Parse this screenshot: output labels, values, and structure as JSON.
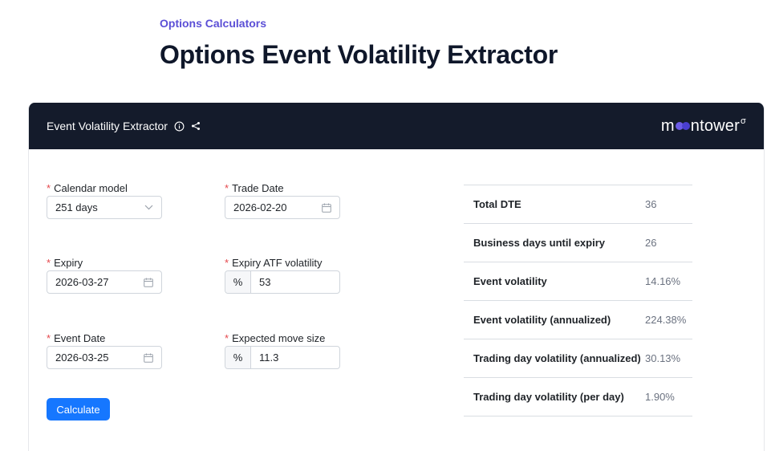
{
  "page": {
    "eyebrow": "Options Calculators",
    "title": "Options Event Volatility Extractor"
  },
  "card": {
    "title": "Event Volatility Extractor",
    "brand": {
      "pre": "m",
      "post": "ntower",
      "sup": "σ"
    }
  },
  "form": {
    "calendar_model": {
      "label": "Calendar model",
      "value": "251 days"
    },
    "trade_date": {
      "label": "Trade Date",
      "value": "2026-02-20"
    },
    "expiry": {
      "label": "Expiry",
      "value": "2026-03-27"
    },
    "expiry_atf_vol": {
      "label": "Expiry ATF volatility",
      "addon": "%",
      "value": "53"
    },
    "event_date": {
      "label": "Event Date",
      "value": "2026-03-25"
    },
    "expected_move": {
      "label": "Expected move size",
      "addon": "%",
      "value": "11.3"
    },
    "calculate_label": "Calculate"
  },
  "results": [
    {
      "label": "Total DTE",
      "value": "36"
    },
    {
      "label": "Business days until expiry",
      "value": "26"
    },
    {
      "label": "Event volatility",
      "value": "14.16%"
    },
    {
      "label": "Event volatility (annualized)",
      "value": "224.38%"
    },
    {
      "label": "Trading day volatility (annualized)",
      "value": "30.13%"
    },
    {
      "label": "Trading day volatility (per day)",
      "value": "1.90%"
    }
  ],
  "colors": {
    "accent": "#1677ff",
    "header_bg": "#141b2b",
    "eyebrow": "#5b4fd6",
    "required": "#e5484d"
  },
  "icons": [
    "info-icon",
    "share-icon",
    "chevron-down-icon",
    "calendar-icon"
  ]
}
